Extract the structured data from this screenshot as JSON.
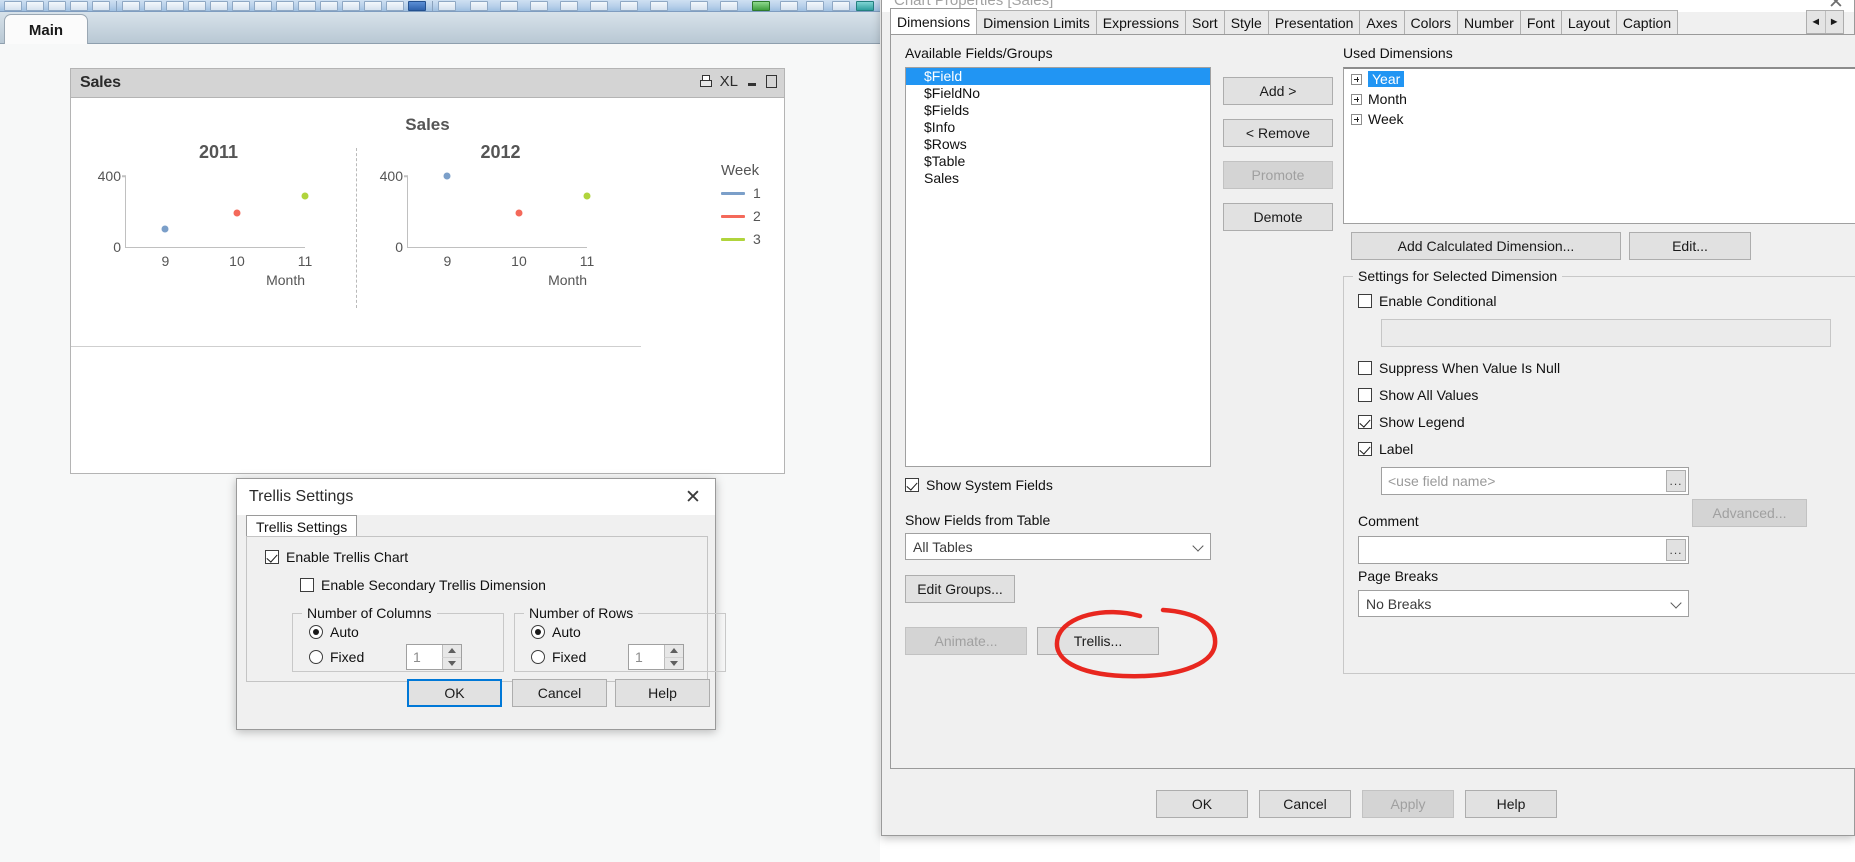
{
  "app": {
    "sheet_tab": "Main"
  },
  "chart_object": {
    "caption_title": "Sales",
    "caption_icons": [
      {
        "name": "print-icon",
        "label": ""
      },
      {
        "name": "export-xl-icon",
        "label": "XL"
      },
      {
        "name": "minimize-icon",
        "label": ""
      },
      {
        "name": "maximize-icon",
        "label": ""
      }
    ]
  },
  "chart_data": {
    "type": "scatter",
    "title": "Sales",
    "xlabel": "Month",
    "ylabel": "",
    "ylim": [
      0,
      400
    ],
    "yticks": [
      0,
      400
    ],
    "xticks": [
      9,
      10,
      11
    ],
    "grid": false,
    "legend_position": "right",
    "legend_title": "Week",
    "trellis_dimension": "Year",
    "panels": [
      {
        "title": "2011",
        "points": [
          {
            "series": "1",
            "x": 9,
            "y": 100,
            "color": "#7b9fc9"
          },
          {
            "series": "2",
            "x": 10,
            "y": 190,
            "color": "#f4695a"
          },
          {
            "series": "3",
            "x": 11,
            "y": 290,
            "color": "#b0d43c"
          }
        ]
      },
      {
        "title": "2012",
        "points": [
          {
            "series": "1",
            "x": 9,
            "y": 400,
            "color": "#7b9fc9"
          },
          {
            "series": "2",
            "x": 10,
            "y": 190,
            "color": "#f4695a"
          },
          {
            "series": "3",
            "x": 11,
            "y": 290,
            "color": "#b0d43c"
          }
        ]
      }
    ],
    "series": [
      {
        "name": "1",
        "color": "#7b9fc9"
      },
      {
        "name": "2",
        "color": "#f4695a"
      },
      {
        "name": "3",
        "color": "#b0d43c"
      }
    ]
  },
  "trellis_dialog": {
    "title": "Trellis Settings",
    "close_label": "✕",
    "tab_label": "Trellis Settings",
    "enable_trellis_label": "Enable Trellis Chart",
    "enable_trellis_checked": true,
    "enable_secondary_label": "Enable Secondary Trellis Dimension",
    "enable_secondary_checked": false,
    "columns_group": {
      "title": "Number of Columns",
      "auto_label": "Auto",
      "fixed_label": "Fixed",
      "selected": "Auto",
      "fixed_value": "1"
    },
    "rows_group": {
      "title": "Number of Rows",
      "auto_label": "Auto",
      "fixed_label": "Fixed",
      "selected": "Auto",
      "fixed_value": "1"
    },
    "buttons": {
      "ok": "OK",
      "cancel": "Cancel",
      "help": "Help"
    }
  },
  "chart_properties": {
    "title": "Chart Properties [Sales]",
    "close_label": "✕",
    "tabs": [
      "Dimensions",
      "Dimension Limits",
      "Expressions",
      "Sort",
      "Style",
      "Presentation",
      "Axes",
      "Colors",
      "Number",
      "Font",
      "Layout",
      "Caption"
    ],
    "active_tab": "Dimensions",
    "tab_scroll_left": "◄",
    "tab_scroll_right": "►",
    "available_label": "Available Fields/Groups",
    "available_fields": [
      {
        "label": "$Field",
        "selected": true
      },
      {
        "label": "$FieldNo",
        "selected": false
      },
      {
        "label": "$Fields",
        "selected": false
      },
      {
        "label": "$Info",
        "selected": false
      },
      {
        "label": "$Rows",
        "selected": false
      },
      {
        "label": "$Table",
        "selected": false
      },
      {
        "label": "Sales",
        "selected": false
      }
    ],
    "middle_buttons": [
      {
        "label": "Add >",
        "disabled": false
      },
      {
        "label": "< Remove",
        "disabled": false
      },
      {
        "label": "Promote",
        "disabled": true
      },
      {
        "label": "Demote",
        "disabled": false
      }
    ],
    "used_label": "Used Dimensions",
    "used_dimensions": [
      {
        "label": "Year",
        "selected": true
      },
      {
        "label": "Month",
        "selected": false
      },
      {
        "label": "Week",
        "selected": false
      }
    ],
    "add_calculated_label": "Add Calculated Dimension...",
    "edit_label": "Edit...",
    "settings_group_title": "Settings for Selected Dimension",
    "enable_conditional_label": "Enable Conditional",
    "enable_conditional_checked": false,
    "conditional_value": "",
    "suppress_null_label": "Suppress When Value Is Null",
    "suppress_null_checked": false,
    "show_all_values_label": "Show All Values",
    "show_all_values_checked": false,
    "show_legend_label": "Show Legend",
    "show_legend_checked": true,
    "label_checkbox_label": "Label",
    "label_checked": true,
    "label_placeholder": "<use field name>",
    "label_value": "",
    "ellipsis_label": "...",
    "advanced_label": "Advanced...",
    "comment_label": "Comment",
    "comment_value": "",
    "page_breaks_label": "Page Breaks",
    "page_breaks_value": "No Breaks",
    "show_system_fields_label": "Show System Fields",
    "show_system_fields_checked": true,
    "show_fields_from_table_label": "Show Fields from Table",
    "show_fields_from_table_value": "All Tables",
    "edit_groups_label": "Edit Groups...",
    "animate_label": "Animate...",
    "trellis_label": "Trellis...",
    "buttons": {
      "ok": "OK",
      "cancel": "Cancel",
      "apply": "Apply",
      "help": "Help"
    }
  },
  "annotation": {
    "color": "#e8271f",
    "shape": "hand-drawn-ellipse-around-trellis-button"
  }
}
